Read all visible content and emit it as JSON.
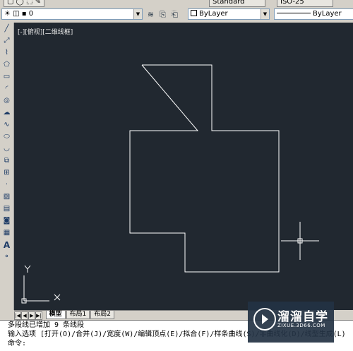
{
  "top_toolbar": {
    "text_style": "Standard",
    "dim_style": "ISO-25"
  },
  "layer_toolbar": {
    "layer_value": "0",
    "color_value": "ByLayer",
    "linetype_value": "ByLayer"
  },
  "viewport": {
    "label": "[-][俯视][二维线框]"
  },
  "tabs": {
    "items": [
      "模型",
      "布局1",
      "布局2"
    ],
    "active": "模型"
  },
  "command": {
    "line1": "多段线已增加 9 条线段",
    "line2": "输入选项 [打开(O)/合并(J)/宽度(W)/编辑顶点(E)/拟合(F)/样条曲线(S)/非曲线化(D)/线型生成(L)",
    "line3": "命令:"
  },
  "watermark": {
    "brand": "溜溜自学",
    "url": "ZIXUE.3D66.COM"
  },
  "colors": {
    "canvas_bg": "#212830",
    "geometry": "#ffffff"
  },
  "left_tools": [
    "line-icon",
    "xline-icon",
    "polyline-icon",
    "polygon-icon",
    "rectangle-icon",
    "arc-icon",
    "circle-icon",
    "revcloud-icon",
    "spline-icon",
    "ellipse-icon",
    "ellipse-arc-icon",
    "insert-block-icon",
    "make-block-icon",
    "point-icon",
    "hatch-icon",
    "gradient-icon",
    "region-icon",
    "table-icon",
    "mtext-icon",
    "add-selected-icon"
  ]
}
